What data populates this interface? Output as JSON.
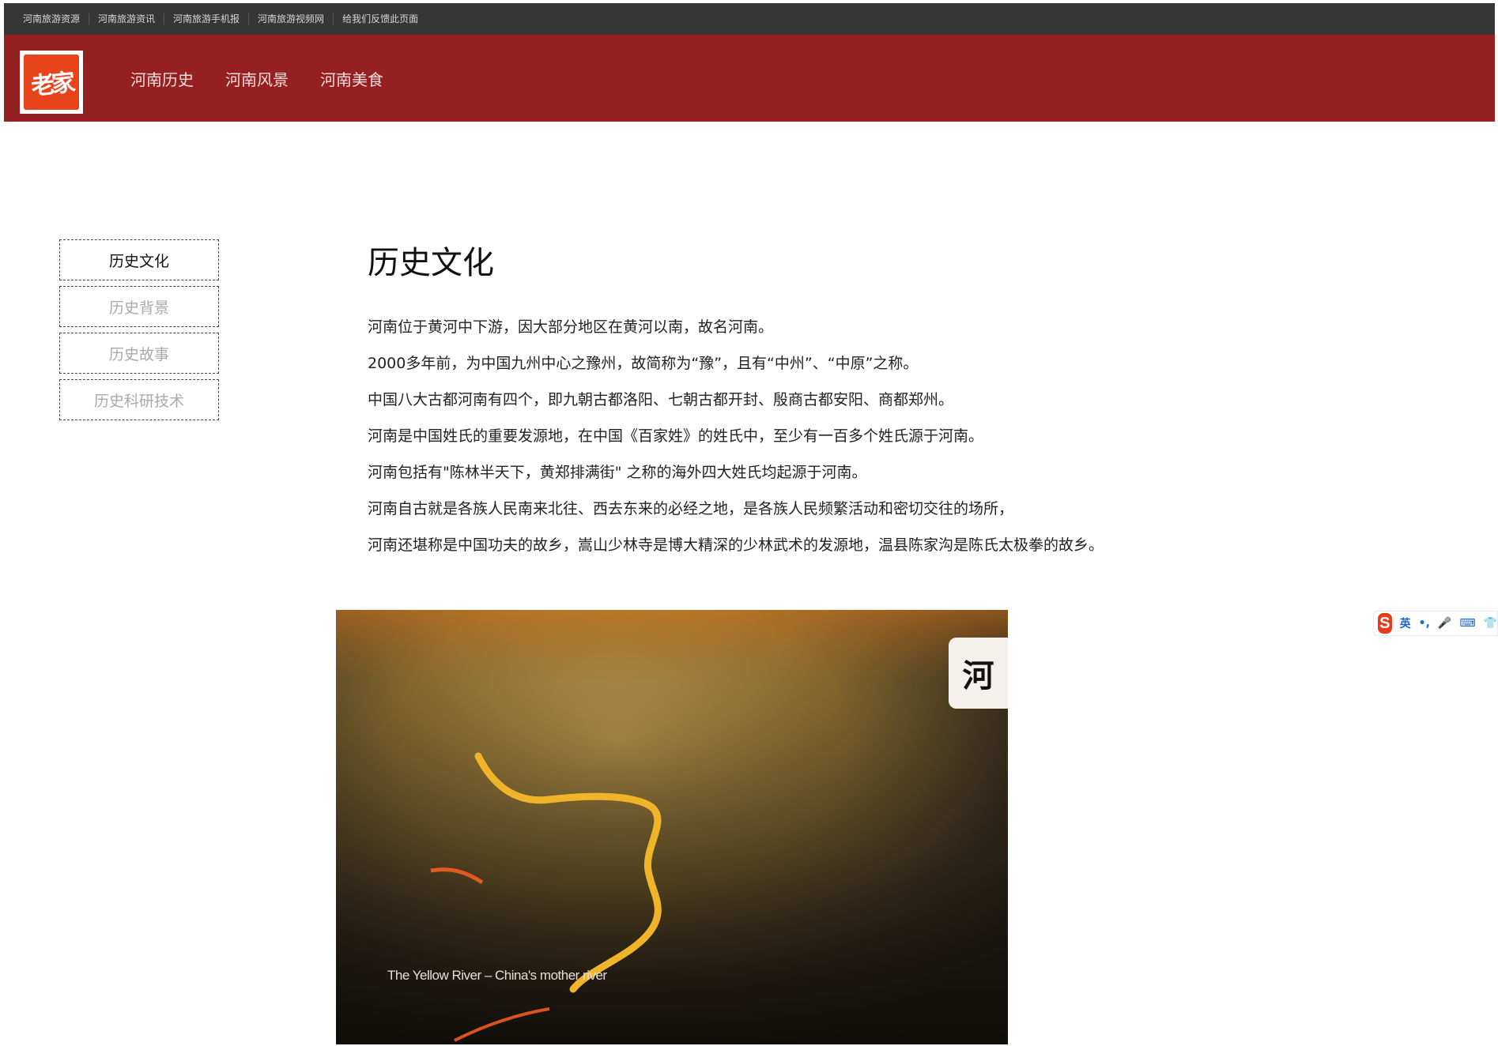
{
  "topbar": {
    "links": [
      "河南旅游资源",
      "河南旅游资讯",
      "河南旅游手机报",
      "河南旅游视频网",
      "给我们反馈此页面"
    ]
  },
  "header": {
    "logo_text": "老家",
    "nav": [
      "河南历史",
      "河南风景",
      "河南美食"
    ]
  },
  "sidebar": {
    "items": [
      "历史文化",
      "历史背景",
      "历史故事",
      "历史科研技术"
    ],
    "active": "历史文化"
  },
  "article": {
    "title": "历史文化",
    "paragraphs": [
      "河南位于黄河中下游，因大部分地区在黄河以南，故名河南。",
      "2000多年前，为中国九州中心之豫州，故简称为“豫”，且有“中州”、“中原”之称。",
      "中国八大古都河南有四个，即九朝古都洛阳、七朝古都开封、殷商古都安阳、商都郑州。",
      "河南是中国姓氏的重要发源地，在中国《百家姓》的姓氏中，至少有一百多个姓氏源于河南。",
      "河南包括有\"陈林半天下，黄郑排满街\" 之称的海外四大姓氏均起源于河南。",
      "河南自古就是各族人民南来北往、西去东来的必经之地，是各族人民频繁活动和密切交往的场所，",
      "河南还堪称是中国功夫的故乡，嵩山少林寺是博大精深的少林武术的发源地，温县陈家沟是陈氏太极拳的故乡。"
    ]
  },
  "video": {
    "caption": "The Yellow River – China's mother river",
    "badge_text": "河"
  },
  "ime": {
    "logo": "S",
    "lang": "英",
    "punct": "•,",
    "mic": "🎤",
    "keyboard": "⌨",
    "skin": "👕"
  },
  "colors": {
    "topbar_bg": "#363636",
    "header_bg": "#962021",
    "logo_red": "#e8441c"
  }
}
